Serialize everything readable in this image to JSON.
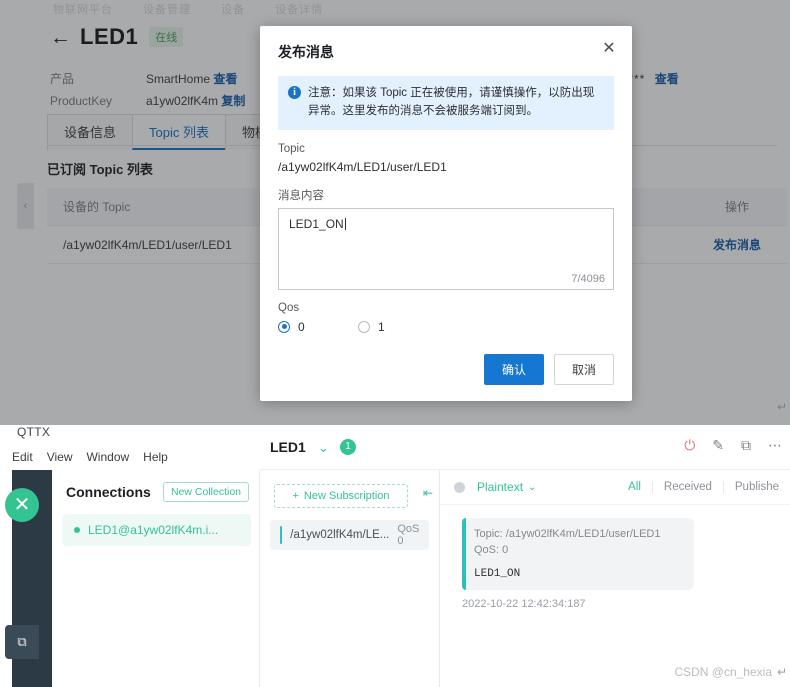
{
  "console": {
    "breadcrumb": [
      "物联网平台",
      "设备管理",
      "设备",
      "设备详情"
    ],
    "back_icon": "←",
    "device_name": "LED1",
    "status_badge": "在线",
    "meta": [
      {
        "label": "产品",
        "value": "SmartHome",
        "action": "查看"
      },
      {
        "label": "ProductKey",
        "value": "a1yw02lfK4m",
        "action": "复制"
      }
    ],
    "secret_mask": "*****",
    "secret_action": "查看",
    "tabs": [
      {
        "label": "设备信息",
        "active": false
      },
      {
        "label": "Topic 列表",
        "active": true
      },
      {
        "label": "物模型数据",
        "active": false
      }
    ],
    "section_title": "已订阅 Topic 列表",
    "table": {
      "columns": [
        "设备的 Topic",
        "操作"
      ],
      "rows": [
        {
          "topic": "/a1yw02lfK4m/LED1/user/LED1",
          "action": "发布消息"
        }
      ]
    },
    "collapse_icon": "‹"
  },
  "modal": {
    "title": "发布消息",
    "close_icon": "✕",
    "alert_icon": "i",
    "alert_text": "注意：如果该 Topic 正在被使用，请谨慎操作，以防出现异常。这里发布的消息不会被服务端订阅到。",
    "topic_label": "Topic",
    "topic_value": "/a1yw02lfK4m/LED1/user/LED1",
    "content_label": "消息内容",
    "content_value": "LED1_ON",
    "char_count": "7/4096",
    "qos_label": "Qos",
    "qos_options": [
      {
        "label": "0",
        "selected": true
      },
      {
        "label": "1",
        "selected": false
      }
    ],
    "confirm_label": "确认",
    "cancel_label": "取消",
    "accent_color": "#1677d2"
  },
  "mqttx": {
    "window_title": "QTTX",
    "win_maximize_icon": "▭",
    "win_close_icon": "⌃",
    "menu": [
      "Edit",
      "View",
      "Window",
      "Help"
    ],
    "rail_logo": "✕",
    "rail_item_icon": "⧉",
    "connections": {
      "title": "Connections",
      "new_collection_label": "New Collection",
      "items": [
        {
          "name": "LED1@a1yw02lfK4m.i..."
        }
      ]
    },
    "topbar": {
      "tab_name": "LED1",
      "chevron_icon": "⌄",
      "badge": "1",
      "power_icon": "⏻",
      "edit_icon": "✎",
      "layers_icon": "⧉",
      "more_icon": "⋯"
    },
    "subscriptions": {
      "new_subscription_label": "New Subscription",
      "plus_icon": "+",
      "collapse_icon": "⇤",
      "items": [
        {
          "topic": "/a1yw02lfK4m/LE...",
          "qos": "QoS 0"
        }
      ]
    },
    "messages": {
      "format_label": "Plaintext",
      "format_caret": "⌄",
      "filters": [
        "All",
        "Received",
        "Publishe"
      ],
      "items": [
        {
          "meta": "Topic: /a1yw02lfK4m/LED1/user/LED1   QoS: 0",
          "payload": "LED1_ON",
          "time": "2022-10-22 12:42:34:187"
        }
      ]
    },
    "accent_color": "#34c491"
  },
  "watermark": "CSDN @cn_hexia",
  "corner_arrow": "↵",
  "edge_arrow": "↵"
}
